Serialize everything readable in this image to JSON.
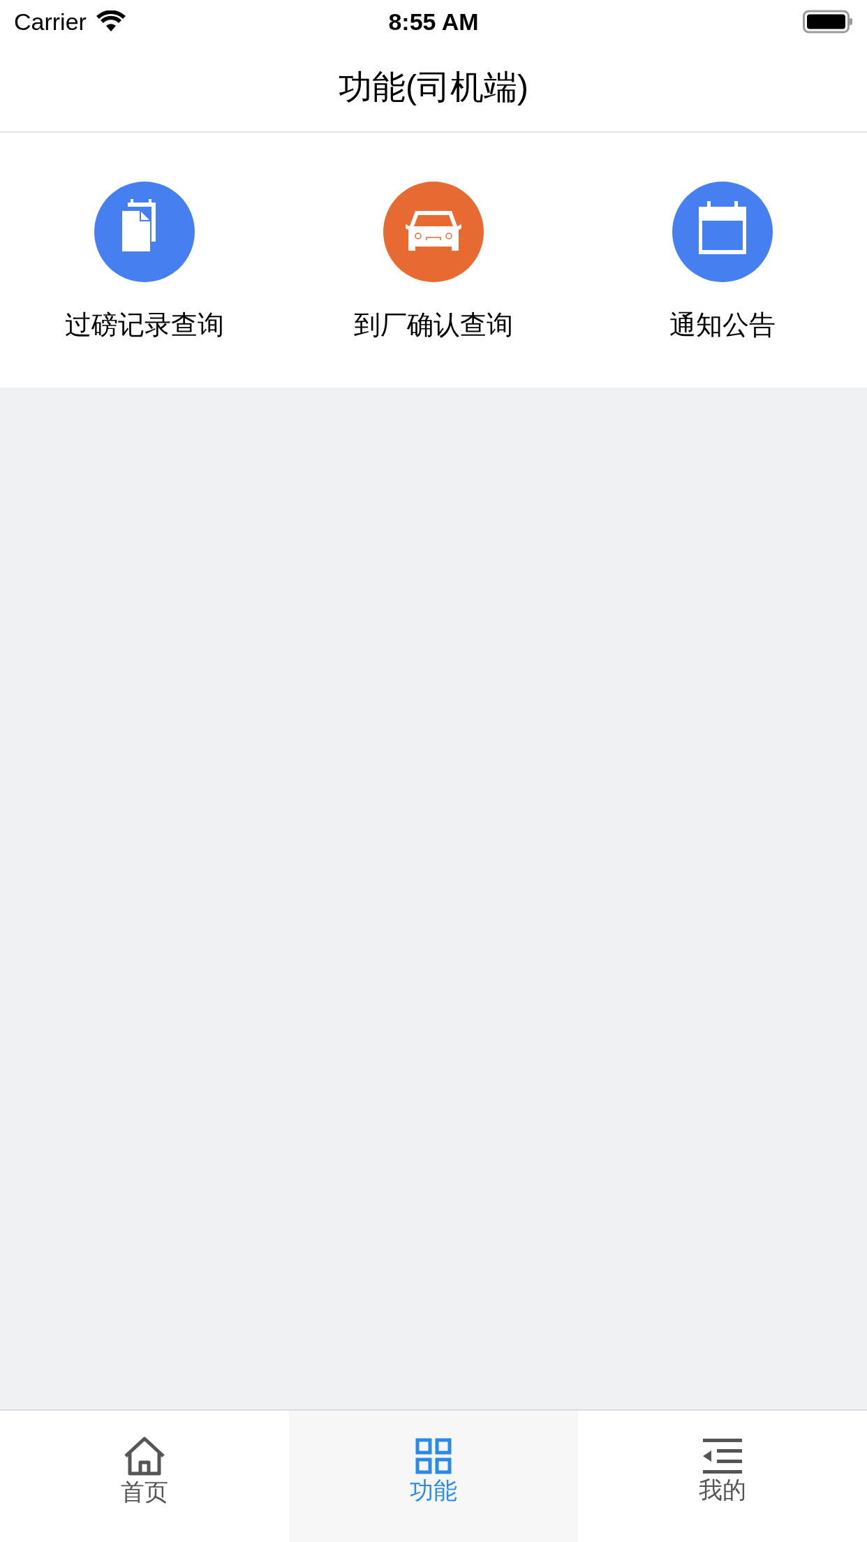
{
  "status_bar": {
    "carrier": "Carrier",
    "time": "8:55 AM"
  },
  "nav_bar": {
    "title": "功能(司机端)"
  },
  "functions": [
    {
      "label": "过磅记录查询",
      "kind": "clipboard",
      "color": "#4680f0"
    },
    {
      "label": "到厂确认查询",
      "kind": "car",
      "color": "#e96a30"
    },
    {
      "label": "通知公告",
      "kind": "calendar",
      "color": "#4680f0"
    }
  ],
  "tab_bar": [
    {
      "label": "首页",
      "kind": "home",
      "selected": false
    },
    {
      "label": "功能",
      "kind": "grid",
      "selected": true
    },
    {
      "label": "我的",
      "kind": "menu",
      "selected": false
    }
  ]
}
